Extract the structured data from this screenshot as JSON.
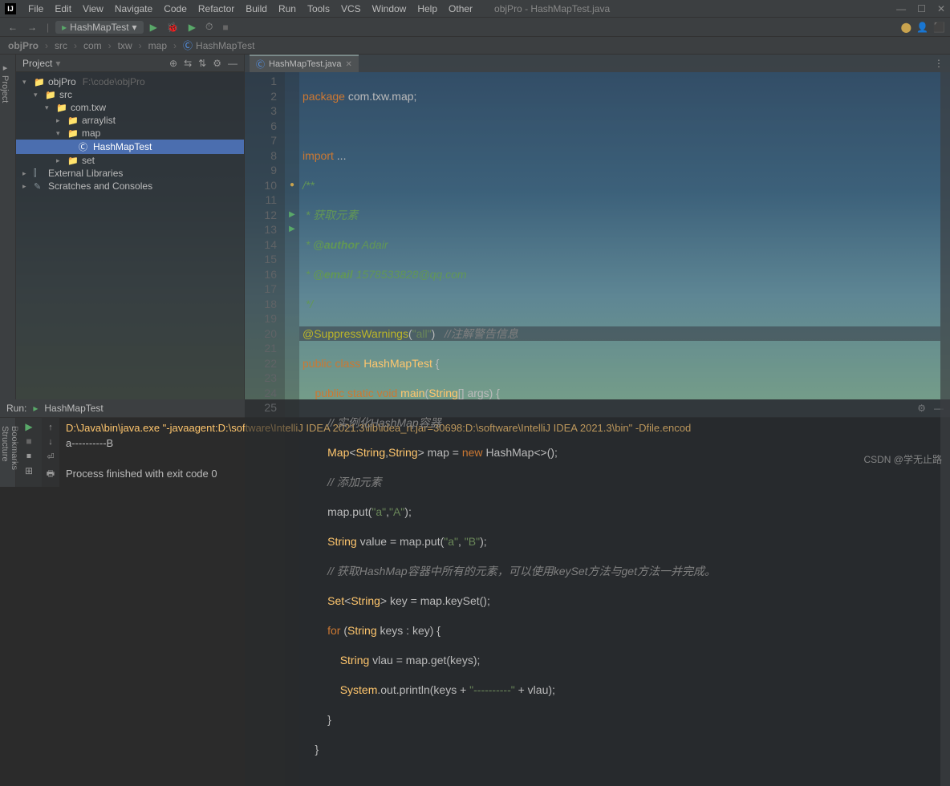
{
  "menu": [
    "File",
    "Edit",
    "View",
    "Navigate",
    "Code",
    "Refactor",
    "Build",
    "Run",
    "Tools",
    "VCS",
    "Window",
    "Help",
    "Other"
  ],
  "window_title": "objPro - HashMapTest.java",
  "toolbar": {
    "run_config": "HashMapTest"
  },
  "breadcrumbs": [
    "objPro",
    "src",
    "com",
    "txw",
    "map",
    "HashMapTest"
  ],
  "project_panel": {
    "title": "Project",
    "tree": [
      {
        "indent": 0,
        "chev": "▾",
        "icon": "📁",
        "label": "objPro",
        "path": "F:\\code\\objPro"
      },
      {
        "indent": 1,
        "chev": "▾",
        "icon": "📁",
        "label": "src",
        "path": ""
      },
      {
        "indent": 2,
        "chev": "▾",
        "icon": "📁",
        "label": "com.txw",
        "path": ""
      },
      {
        "indent": 3,
        "chev": "▸",
        "icon": "📁",
        "label": "arraylist",
        "path": ""
      },
      {
        "indent": 3,
        "chev": "▾",
        "icon": "📁",
        "label": "map",
        "path": ""
      },
      {
        "indent": 4,
        "chev": "",
        "icon": "Ⓒ",
        "label": "HashMapTest",
        "path": "",
        "selected": true
      },
      {
        "indent": 3,
        "chev": "▸",
        "icon": "📁",
        "label": "set",
        "path": ""
      },
      {
        "indent": 0,
        "chev": "▸",
        "icon": "⫿",
        "label": "External Libraries",
        "path": ""
      },
      {
        "indent": 0,
        "chev": "▸",
        "icon": "✎",
        "label": "Scratches and Consoles",
        "path": ""
      }
    ]
  },
  "editor_tab": "HashMapTest.java",
  "line_numbers": [
    "1",
    "2",
    "3",
    "6",
    "7",
    "8",
    "9",
    "10",
    "11",
    "12",
    "13",
    "14",
    "15",
    "16",
    "17",
    "18",
    "19",
    "20",
    "21",
    "22",
    "23",
    "24",
    "25"
  ],
  "code": {
    "l1a": "package ",
    "l1b": "com.txw.map",
    "l3a": "import ",
    "l3b": "...",
    "l6": "/**",
    "l7": " * 获取元素",
    "l8a": " * ",
    "l8b": "@author",
    "l8c": " Adair",
    "l9a": " * ",
    "l9b": "@email",
    "l9c": " 1578533828@qq.com",
    "l10": " */",
    "l11a": "@SuppressWarnings",
    "l11b": "(",
    "l11c": "\"all\"",
    "l11d": ")   ",
    "l11e": "//注解警告信息",
    "l12a": "public class ",
    "l12b": "HashMapTest",
    " l12c": " {",
    "l13a": "    public static void ",
    "l13b": "main",
    "l13c": "(",
    "l13d": "String",
    "l13e": "[] args) {",
    "l14": "        // 实例化HashMap容器",
    "l15a": "        ",
    "l15b": "Map",
    "l15c": "<",
    "l15d": "String",
    "l15e": ",",
    "l15f": "String",
    "l15g": "> map = ",
    "l15h": "new ",
    "l15i": "HashMap<>();",
    "l16": "        // 添加元素",
    "l17a": "        map.put(",
    "l17b": "\"a\"",
    "l17c": ",",
    "l17d": "\"A\"",
    "l17e": ");",
    "l18a": "        ",
    "l18b": "String",
    "l18c": " value = map.put(",
    "l18d": "\"a\"",
    "l18e": ", ",
    "l18f": "\"B\"",
    "l18g": ");",
    "l19": "        // 获取HashMap容器中所有的元素，可以使用keySet方法与get方法一并完成。",
    "l20a": "        ",
    "l20b": "Set",
    "l20c": "<",
    "l20d": "String",
    "l20e": "> key = map.keySet();",
    "l21a": "        ",
    "l21b": "for ",
    "l21c": "(",
    "l21d": "String",
    "l21e": " keys : key) {",
    "l22a": "            ",
    "l22b": "String",
    "l22c": " vlau = map.get(keys);",
    "l23a": "            ",
    "l23b": "System",
    "l23c": ".out.println(keys + ",
    "l23d": "\"----------\"",
    "l23e": " + vlau);",
    "l24": "        }",
    "l25": "    }"
  },
  "run": {
    "label": "Run:",
    "tab": "HashMapTest",
    "cmd": "D:\\Java\\bin\\java.exe \"-javaagent:D:\\software\\IntelliJ IDEA 2021.3\\lib\\idea_rt.jar=30698:D:\\software\\IntelliJ IDEA 2021.3\\bin\" -Dfile.encod",
    "out1": "a----------B",
    "out2": "",
    "out3": "Process finished with exit code 0"
  },
  "watermark": "CSDN @学无止路"
}
